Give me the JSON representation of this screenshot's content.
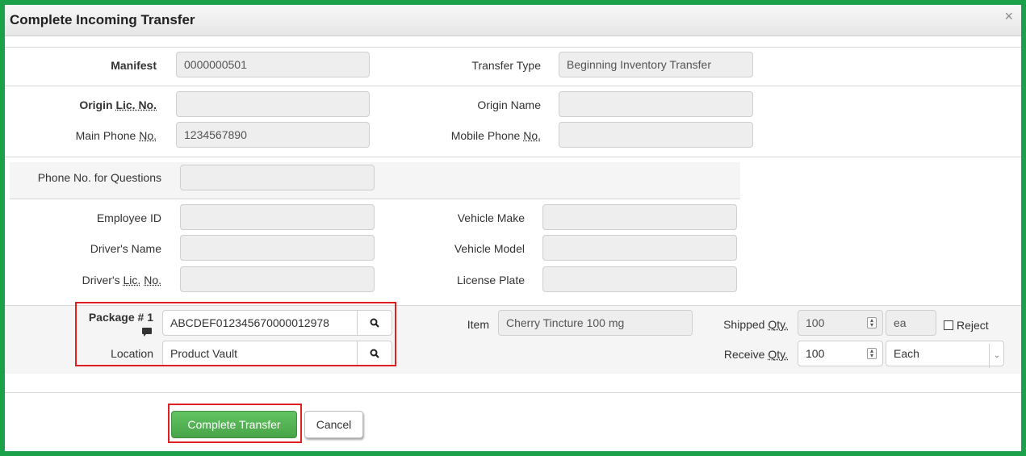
{
  "dialog": {
    "title": "Complete Incoming Transfer",
    "close_glyph": "×"
  },
  "manifest": {
    "label": "Manifest",
    "value": "0000000501"
  },
  "transfer_type": {
    "label": "Transfer Type",
    "value": "Beginning Inventory Transfer"
  },
  "origin_lic": {
    "label_prefix": "Origin ",
    "label_abbr": "Lic. No.",
    "value": ""
  },
  "origin_name": {
    "label": "Origin Name",
    "value": ""
  },
  "main_phone": {
    "label_prefix": "Main Phone ",
    "label_abbr": "No.",
    "value": "1234567890"
  },
  "mobile_phone": {
    "label_prefix": "Mobile Phone ",
    "label_abbr": "No.",
    "value": ""
  },
  "phone_questions": {
    "label": "Phone No. for Questions",
    "value": ""
  },
  "employee_id": {
    "label": "Employee ID",
    "value": ""
  },
  "drivers_name": {
    "label": "Driver's Name",
    "value": ""
  },
  "drivers_lic": {
    "label_prefix": "Driver's ",
    "label_lic": "Lic.",
    "label_no": "No.",
    "value": ""
  },
  "vehicle_make": {
    "label": "Vehicle Make",
    "value": ""
  },
  "vehicle_model": {
    "label": "Vehicle Model",
    "value": ""
  },
  "license_plate": {
    "label": "License Plate",
    "value": ""
  },
  "package": {
    "label": "Package # 1",
    "value": "ABCDEF012345670000012978",
    "search_icon": "search-icon",
    "comment_icon": "comment-icon"
  },
  "location": {
    "label": "Location",
    "value": "Product Vault",
    "search_icon": "search-icon"
  },
  "item": {
    "label": "Item",
    "value": "Cherry Tincture 100 mg"
  },
  "shipped_qty": {
    "label_prefix": "Shipped ",
    "label_abbr": "Qty.",
    "value": "100",
    "unit": "ea"
  },
  "reject": {
    "label": "Reject",
    "checked": false
  },
  "receive_qty": {
    "label_prefix": "Receive ",
    "label_abbr": "Qty.",
    "value": "100",
    "unit": "Each"
  },
  "buttons": {
    "complete": "Complete Transfer",
    "cancel": "Cancel"
  },
  "colors": {
    "highlight": "#e02020",
    "frame": "#1aa14a",
    "primary": "#5cb85c"
  }
}
